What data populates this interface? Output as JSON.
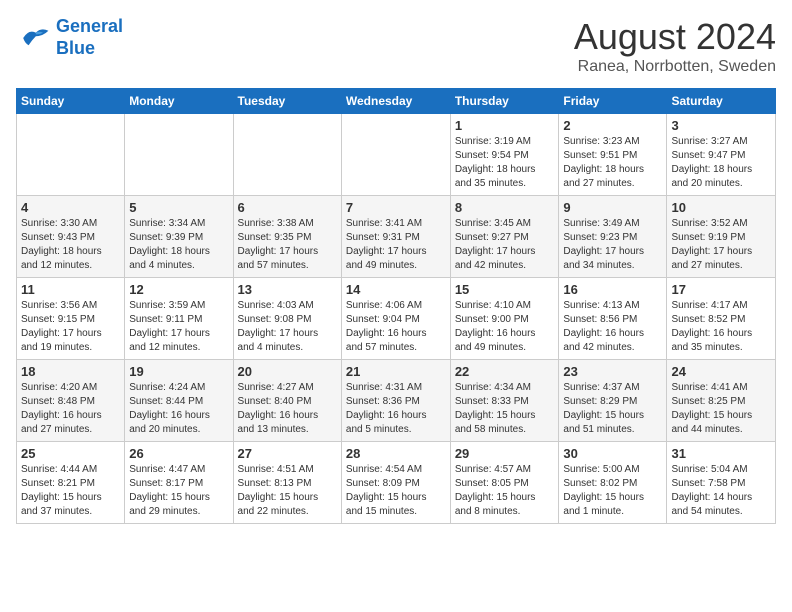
{
  "header": {
    "logo_line1": "General",
    "logo_line2": "Blue",
    "title": "August 2024",
    "subtitle": "Ranea, Norrbotten, Sweden"
  },
  "calendar": {
    "days_of_week": [
      "Sunday",
      "Monday",
      "Tuesday",
      "Wednesday",
      "Thursday",
      "Friday",
      "Saturday"
    ],
    "weeks": [
      [
        {
          "day": "",
          "info": ""
        },
        {
          "day": "",
          "info": ""
        },
        {
          "day": "",
          "info": ""
        },
        {
          "day": "",
          "info": ""
        },
        {
          "day": "1",
          "info": "Sunrise: 3:19 AM\nSunset: 9:54 PM\nDaylight: 18 hours and 35 minutes."
        },
        {
          "day": "2",
          "info": "Sunrise: 3:23 AM\nSunset: 9:51 PM\nDaylight: 18 hours and 27 minutes."
        },
        {
          "day": "3",
          "info": "Sunrise: 3:27 AM\nSunset: 9:47 PM\nDaylight: 18 hours and 20 minutes."
        }
      ],
      [
        {
          "day": "4",
          "info": "Sunrise: 3:30 AM\nSunset: 9:43 PM\nDaylight: 18 hours and 12 minutes."
        },
        {
          "day": "5",
          "info": "Sunrise: 3:34 AM\nSunset: 9:39 PM\nDaylight: 18 hours and 4 minutes."
        },
        {
          "day": "6",
          "info": "Sunrise: 3:38 AM\nSunset: 9:35 PM\nDaylight: 17 hours and 57 minutes."
        },
        {
          "day": "7",
          "info": "Sunrise: 3:41 AM\nSunset: 9:31 PM\nDaylight: 17 hours and 49 minutes."
        },
        {
          "day": "8",
          "info": "Sunrise: 3:45 AM\nSunset: 9:27 PM\nDaylight: 17 hours and 42 minutes."
        },
        {
          "day": "9",
          "info": "Sunrise: 3:49 AM\nSunset: 9:23 PM\nDaylight: 17 hours and 34 minutes."
        },
        {
          "day": "10",
          "info": "Sunrise: 3:52 AM\nSunset: 9:19 PM\nDaylight: 17 hours and 27 minutes."
        }
      ],
      [
        {
          "day": "11",
          "info": "Sunrise: 3:56 AM\nSunset: 9:15 PM\nDaylight: 17 hours and 19 minutes."
        },
        {
          "day": "12",
          "info": "Sunrise: 3:59 AM\nSunset: 9:11 PM\nDaylight: 17 hours and 12 minutes."
        },
        {
          "day": "13",
          "info": "Sunrise: 4:03 AM\nSunset: 9:08 PM\nDaylight: 17 hours and 4 minutes."
        },
        {
          "day": "14",
          "info": "Sunrise: 4:06 AM\nSunset: 9:04 PM\nDaylight: 16 hours and 57 minutes."
        },
        {
          "day": "15",
          "info": "Sunrise: 4:10 AM\nSunset: 9:00 PM\nDaylight: 16 hours and 49 minutes."
        },
        {
          "day": "16",
          "info": "Sunrise: 4:13 AM\nSunset: 8:56 PM\nDaylight: 16 hours and 42 minutes."
        },
        {
          "day": "17",
          "info": "Sunrise: 4:17 AM\nSunset: 8:52 PM\nDaylight: 16 hours and 35 minutes."
        }
      ],
      [
        {
          "day": "18",
          "info": "Sunrise: 4:20 AM\nSunset: 8:48 PM\nDaylight: 16 hours and 27 minutes."
        },
        {
          "day": "19",
          "info": "Sunrise: 4:24 AM\nSunset: 8:44 PM\nDaylight: 16 hours and 20 minutes."
        },
        {
          "day": "20",
          "info": "Sunrise: 4:27 AM\nSunset: 8:40 PM\nDaylight: 16 hours and 13 minutes."
        },
        {
          "day": "21",
          "info": "Sunrise: 4:31 AM\nSunset: 8:36 PM\nDaylight: 16 hours and 5 minutes."
        },
        {
          "day": "22",
          "info": "Sunrise: 4:34 AM\nSunset: 8:33 PM\nDaylight: 15 hours and 58 minutes."
        },
        {
          "day": "23",
          "info": "Sunrise: 4:37 AM\nSunset: 8:29 PM\nDaylight: 15 hours and 51 minutes."
        },
        {
          "day": "24",
          "info": "Sunrise: 4:41 AM\nSunset: 8:25 PM\nDaylight: 15 hours and 44 minutes."
        }
      ],
      [
        {
          "day": "25",
          "info": "Sunrise: 4:44 AM\nSunset: 8:21 PM\nDaylight: 15 hours and 37 minutes."
        },
        {
          "day": "26",
          "info": "Sunrise: 4:47 AM\nSunset: 8:17 PM\nDaylight: 15 hours and 29 minutes."
        },
        {
          "day": "27",
          "info": "Sunrise: 4:51 AM\nSunset: 8:13 PM\nDaylight: 15 hours and 22 minutes."
        },
        {
          "day": "28",
          "info": "Sunrise: 4:54 AM\nSunset: 8:09 PM\nDaylight: 15 hours and 15 minutes."
        },
        {
          "day": "29",
          "info": "Sunrise: 4:57 AM\nSunset: 8:05 PM\nDaylight: 15 hours and 8 minutes."
        },
        {
          "day": "30",
          "info": "Sunrise: 5:00 AM\nSunset: 8:02 PM\nDaylight: 15 hours and 1 minute."
        },
        {
          "day": "31",
          "info": "Sunrise: 5:04 AM\nSunset: 7:58 PM\nDaylight: 14 hours and 54 minutes."
        }
      ]
    ]
  }
}
